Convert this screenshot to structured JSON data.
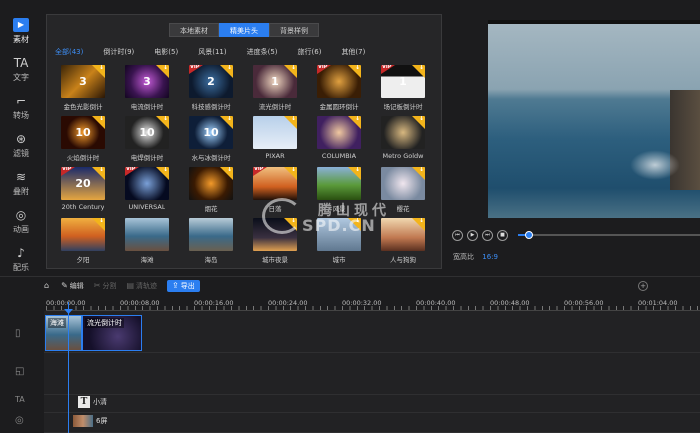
{
  "sidebar": {
    "items": [
      {
        "label": "素材",
        "icon": "play-square-icon",
        "glyph": "▶",
        "active": true
      },
      {
        "label": "文字",
        "icon": "text-icon",
        "glyph": "TA"
      },
      {
        "label": "转场",
        "icon": "transition-icon",
        "glyph": "⌐"
      },
      {
        "label": "滤镜",
        "icon": "filter-icon",
        "glyph": "⊛"
      },
      {
        "label": "叠附",
        "icon": "overlay-icon",
        "glyph": "≋"
      },
      {
        "label": "动画",
        "icon": "animation-icon",
        "glyph": "◎"
      },
      {
        "label": "配乐",
        "icon": "music-icon",
        "glyph": "♪"
      }
    ]
  },
  "library": {
    "tabs": [
      {
        "label": "本地素材"
      },
      {
        "label": "精美片头",
        "active": true
      },
      {
        "label": "背景样例"
      }
    ],
    "categories": [
      {
        "label": "全部(43)",
        "active": true
      },
      {
        "label": "倒计时(9)"
      },
      {
        "label": "电影(5)"
      },
      {
        "label": "风景(11)"
      },
      {
        "label": "进度条(5)"
      },
      {
        "label": "旅行(6)"
      },
      {
        "label": "其他(7)"
      }
    ],
    "items": [
      {
        "label": "金色光影倒计",
        "bg": "linear-gradient(135deg,#3a2408,#c9821a,#2a1605)",
        "glyph": "3",
        "vip": false,
        "dl": true
      },
      {
        "label": "电流倒计时",
        "bg": "radial-gradient(circle,#c35bd6,#3a1450 60%,#120520)",
        "glyph": "3",
        "vip": false,
        "dl": true
      },
      {
        "label": "科技感倒计时",
        "bg": "radial-gradient(circle,#3c6ea0,#0d1a2e 70%)",
        "glyph": "2",
        "vip": true,
        "dl": true
      },
      {
        "label": "流光倒计时",
        "bg": "radial-gradient(circle,#f0d6c0,#4a2a3a 70%)",
        "glyph": "1",
        "vip": false,
        "dl": true
      },
      {
        "label": "金属圆环倒计",
        "bg": "radial-gradient(circle,#e0a040,#3a1e05 70%)",
        "glyph": "",
        "vip": true,
        "dl": true
      },
      {
        "label": "场记板倒计时",
        "bg": "linear-gradient(180deg,#111 0 35%,#eee 35% 100%)",
        "glyph": "1",
        "vip": true,
        "dl": true
      },
      {
        "label": "火焰倒计时",
        "bg": "radial-gradient(circle,#f39a2a,#2a0a02 60%)",
        "glyph": "10",
        "vip": false,
        "dl": true
      },
      {
        "label": "电焊倒计时",
        "bg": "radial-gradient(circle,#e5e5e5,#222 60%)",
        "glyph": "10",
        "vip": false,
        "dl": true
      },
      {
        "label": "水与冰倒计时",
        "bg": "radial-gradient(circle,#9fd1ff,#0e1e38 60%)",
        "glyph": "10",
        "vip": false,
        "dl": true
      },
      {
        "label": "PIXAR",
        "bg": "linear-gradient(180deg,#b8d0ea,#e7eef7)",
        "glyph": "",
        "vip": false,
        "dl": true
      },
      {
        "label": "COLUMBIA",
        "bg": "radial-gradient(circle,#f0c8a0,#402060 70%)",
        "glyph": "",
        "vip": false,
        "dl": true
      },
      {
        "label": "Metro Goldw",
        "bg": "radial-gradient(circle,#d8b880,#222 70%)",
        "glyph": "",
        "vip": false,
        "dl": true
      },
      {
        "label": "20th Century",
        "bg": "linear-gradient(180deg,#1a2a6a,#e6a640)",
        "glyph": "20",
        "vip": true,
        "dl": true
      },
      {
        "label": "UNIVERSAL",
        "bg": "radial-gradient(circle,#7aa0d8,#050a20 70%)",
        "glyph": "",
        "vip": true,
        "dl": true
      },
      {
        "label": "烟花",
        "bg": "radial-gradient(circle,#f39a2a,#3a1a02 60%,#111)",
        "glyph": "",
        "vip": false,
        "dl": true
      },
      {
        "label": "日落",
        "bg": "linear-gradient(180deg,#f0c080,#d06020 60%,#201008)",
        "glyph": "",
        "vip": true,
        "dl": true
      },
      {
        "label": "风景",
        "bg": "linear-gradient(180deg,#8ab0d8,#5a9a3a 55%,#2a5010)",
        "glyph": "",
        "vip": false,
        "dl": true
      },
      {
        "label": "樱花",
        "bg": "radial-gradient(circle,#f0e6ee,#7a8aa0 70%)",
        "glyph": "",
        "vip": false,
        "dl": true
      },
      {
        "label": "夕阳",
        "bg": "linear-gradient(180deg,#f0b040,#d06020 55%,#304060)",
        "glyph": "",
        "vip": false,
        "dl": true
      },
      {
        "label": "海滩",
        "bg": "linear-gradient(180deg,#a8c4d8,#3a6a8a 55%,#6a5040)",
        "glyph": "",
        "vip": false,
        "dl": false
      },
      {
        "label": "海岛",
        "bg": "linear-gradient(180deg,#b8ccd8,#3a6a8a 55%,#6a6050)",
        "glyph": "",
        "vip": false,
        "dl": false
      },
      {
        "label": "城市夜景",
        "bg": "linear-gradient(180deg,#0a0e1a,#3a3040 60%,#e0a050)",
        "glyph": "",
        "vip": false,
        "dl": true
      },
      {
        "label": "城市",
        "bg": "linear-gradient(180deg,#b0c8e0,#607890)",
        "glyph": "",
        "vip": false,
        "dl": true
      },
      {
        "label": "人与狗狗",
        "bg": "linear-gradient(180deg,#f0d8b0,#c07850 60%,#5a3020)",
        "glyph": "",
        "vip": false,
        "dl": true
      }
    ]
  },
  "preview": {
    "ratio_label": "宽高比",
    "ratio_value": "16:9",
    "progress": 0.06
  },
  "controls": [
    {
      "name": "rewind-button",
      "glyph": "⏮"
    },
    {
      "name": "play-button",
      "glyph": "▶"
    },
    {
      "name": "forward-button",
      "glyph": "⏭"
    },
    {
      "name": "stop-button",
      "glyph": "■"
    }
  ],
  "toolbar": {
    "home_icon": "⌂",
    "edit": "编辑",
    "split": "分割",
    "clear": "清轨迹",
    "export": "导出"
  },
  "ruler": {
    "labels": [
      "00:00:00.00",
      "00:00:08.00",
      "00:00:16.00",
      "00:00:24.00",
      "00:00:32.00",
      "00:00:40.00",
      "00:00:48.00",
      "00:00:56.00",
      "00:01:04.00"
    ]
  },
  "timeline": {
    "clip1": "海滩",
    "clip2": "流光倒计时",
    "text_clip": "小清",
    "fx_clip": "6屏",
    "text_track_glyph": "T"
  },
  "watermark": {
    "cn": "腾山现代",
    "en": "SPD.CN"
  }
}
